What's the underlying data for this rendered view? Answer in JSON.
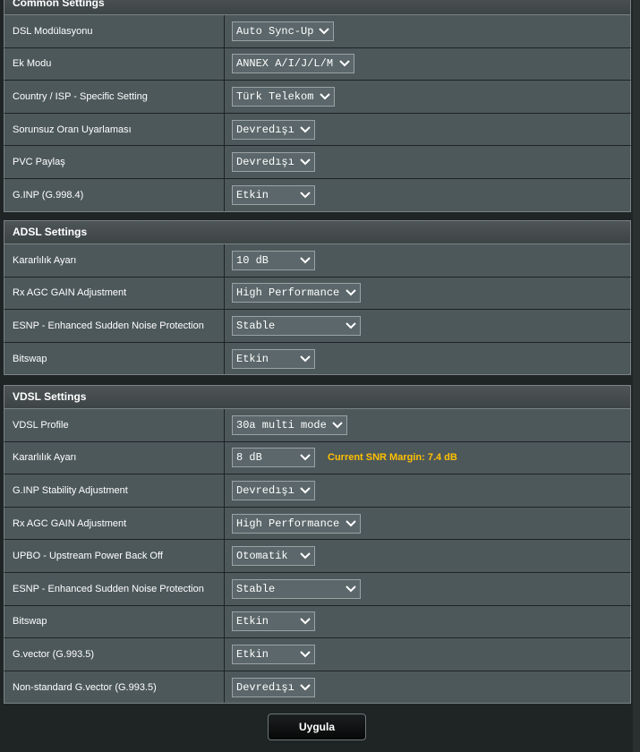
{
  "common": {
    "title": "Common Settings",
    "rows": [
      {
        "label": "DSL Modülasyonu",
        "value": "Auto Sync-Up"
      },
      {
        "label": "Ek Modu",
        "value": "ANNEX A/I/J/L/M"
      },
      {
        "label": "Country / ISP - Specific Setting",
        "value": "Türk Telekom"
      },
      {
        "label": "Sorunsuz Oran Uyarlaması",
        "value": "Devredışı"
      },
      {
        "label": "PVC Paylaş",
        "value": "Devredışı"
      },
      {
        "label": "G.INP (G.998.4)",
        "value": "Etkin"
      }
    ]
  },
  "adsl": {
    "title": "ADSL Settings",
    "rows": [
      {
        "label": "Kararlılık Ayarı",
        "value": "10 dB"
      },
      {
        "label": "Rx AGC GAIN Adjustment",
        "value": "High Performance"
      },
      {
        "label": "ESNP - Enhanced Sudden Noise Protection",
        "value": "Stable"
      },
      {
        "label": "Bitswap",
        "value": "Etkin"
      }
    ]
  },
  "vdsl": {
    "title": "VDSL Settings",
    "rows": [
      {
        "label": "VDSL Profile",
        "value": "30a multi mode"
      },
      {
        "label": "Kararlılık Ayarı",
        "value": "8 dB",
        "note": "Current SNR Margin: 7.4 dB"
      },
      {
        "label": "G.INP Stability Adjustment",
        "value": "Devredışı"
      },
      {
        "label": "Rx AGC GAIN Adjustment",
        "value": "High Performance"
      },
      {
        "label": "UPBO - Upstream Power Back Off",
        "value": "Otomatik"
      },
      {
        "label": "ESNP - Enhanced Sudden Noise Protection",
        "value": "Stable"
      },
      {
        "label": "Bitswap",
        "value": "Etkin"
      },
      {
        "label": "G.vector (G.993.5)",
        "value": "Etkin"
      },
      {
        "label": "Non-standard G.vector (G.993.5)",
        "value": "Devredışı"
      }
    ]
  },
  "apply_label": "Uygula",
  "colors": {
    "note": "#ffc000",
    "row_bg": "#4d585b",
    "header_bg": "#4e5557"
  }
}
